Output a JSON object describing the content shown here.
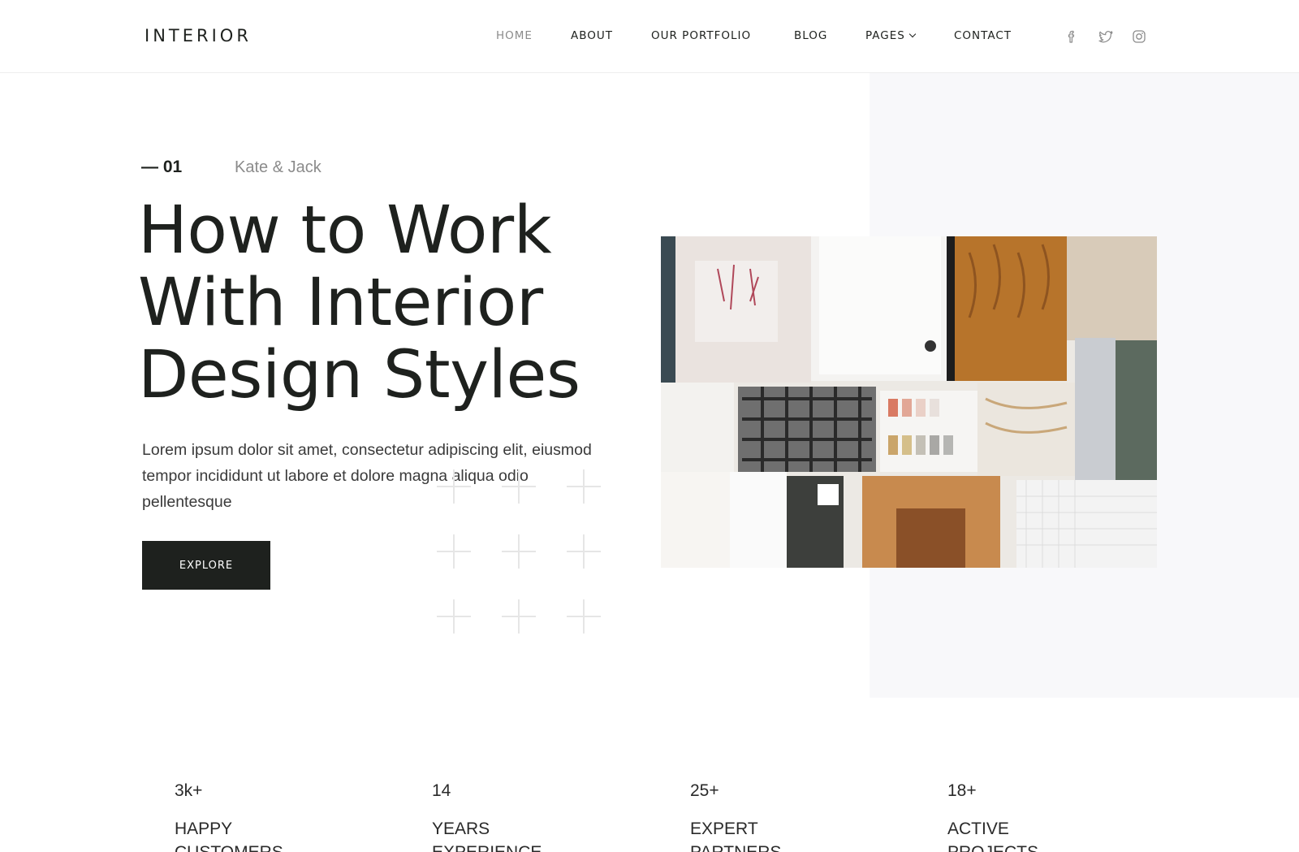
{
  "header": {
    "logo": "INTERIOR",
    "nav": [
      {
        "label": "HOME",
        "active": true
      },
      {
        "label": "ABOUT",
        "active": false
      },
      {
        "label": "OUR PORTFOLIO",
        "active": false
      },
      {
        "label": "BLOG",
        "active": false
      },
      {
        "label": "PAGES",
        "active": false,
        "has_dropdown": true
      },
      {
        "label": "CONTACT",
        "active": false
      }
    ],
    "social_icons": [
      "facebook-icon",
      "twitter-icon",
      "instagram-icon"
    ]
  },
  "hero": {
    "slide_number": "— 01",
    "author": "Kate & Jack",
    "title_lines": [
      "How to Work",
      "With Interior",
      "Design Styles"
    ],
    "description": "Lorem ipsum dolor sit amet, consectetur adipiscing elit, eiusmod tempor incididunt ut labore et dolore magna aliqua odio pellentesque",
    "button_label": "EXPLORE"
  },
  "stats": [
    {
      "value": "3k+",
      "label": "HAPPY CUSTOMERS"
    },
    {
      "value": "14",
      "label": "YEARS EXPERIENCE"
    },
    {
      "value": "25+",
      "label": "EXPERT PARTNERS"
    },
    {
      "value": "18+",
      "label": "ACTIVE PROJECTS"
    }
  ],
  "colors": {
    "primary": "#1e211e",
    "muted": "#8b8b8b",
    "panel_bg": "#f8f8fa"
  }
}
